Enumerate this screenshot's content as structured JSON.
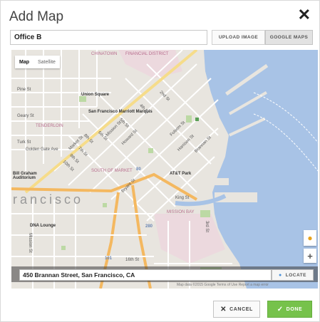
{
  "dialog": {
    "title": "Add Map",
    "close_icon": "close-icon"
  },
  "name_field": {
    "value": "Office B"
  },
  "source_tabs": {
    "upload_label": "UPLOAD IMAGE",
    "google_label": "GOOGLE MAPS",
    "selected": "GOOGLE MAPS"
  },
  "map": {
    "type_control": {
      "map_label": "Map",
      "satellite_label": "Satellite",
      "selected": "Map"
    },
    "labels": {
      "chinatown": "CHINATOWN",
      "financial_district": "FINANCIAL DISTRICT",
      "union_square": "Union Square",
      "sf_marriott": "San Francisco Marriott Marquis",
      "tenderloin": "TENDERLOIN",
      "geary": "Geary St",
      "pine": "Pine St",
      "turk": "Turk St",
      "golden_gate": "Golden Gate Ave",
      "market": "Market St",
      "mission_st": "Mission St",
      "howard": "Howard St",
      "folsom": "Folsom St",
      "harrison": "Harrison St",
      "bryant": "Bryant St",
      "brannan": "Brannan St",
      "king": "King St",
      "second": "2nd St",
      "third": "3rd St",
      "fourth": "4th St",
      "fifth": "5th St",
      "sixth": "6th St",
      "seventh": "7th St",
      "eighth": "8th St",
      "ninth": "9th St",
      "tenth": "10th St",
      "sixteenth": "16th St",
      "south_of_market": "SOUTH OF MARKET",
      "att_park": "AT&T Park",
      "mission_bay": "MISSION BAY",
      "francisco": "rancisco",
      "bill_graham": "Bill Graham Auditorium",
      "dna_lounge": "DNA Lounge",
      "mission_district": "Mission St",
      "shield_101": "101",
      "shield_80": "80",
      "shield_280": "280"
    },
    "pegman_icon": "pegman-icon",
    "zoom_in_label": "+",
    "attribution": "Map data ©2015 Google   Terms of Use   Report a map error"
  },
  "address_field": {
    "value": "450 Brannan Street, San Francisco, CA"
  },
  "locate_button": {
    "label": "LOCATE",
    "icon": "location-pin-icon"
  },
  "footer": {
    "cancel_label": "CANCEL",
    "done_label": "DONE"
  },
  "colors": {
    "done_green": "#76c24b",
    "water": "#a8c3e6",
    "land": "#e8e5df"
  }
}
